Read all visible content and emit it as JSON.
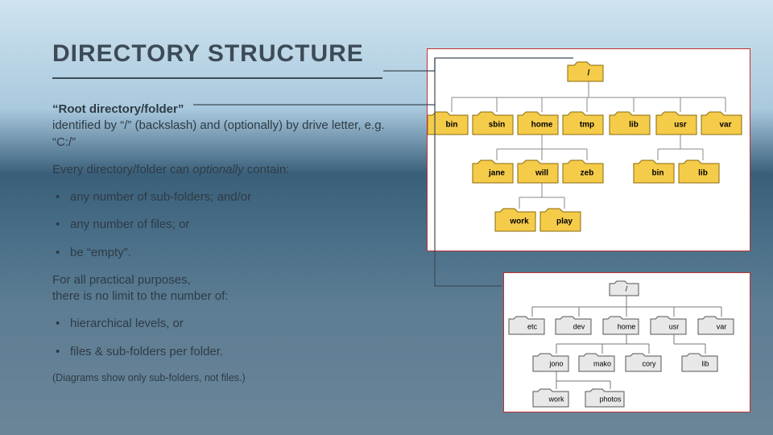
{
  "title": "DIRECTORY STRUCTURE",
  "para1_bold": "“Root directory/folder”",
  "para1_rest": "identified by “/” (backslash) and (optionally) by drive letter, e.g. “C:/”",
  "para2_pre": "Every directory/folder can ",
  "para2_em": "optionally",
  "para2_post": " contain:",
  "list1": [
    "any number of sub-folders; and/or",
    "any number of files; or",
    "be “empty”."
  ],
  "para3": "For all practical purposes,\nthere is no limit to the number of:",
  "list2": [
    "hierarchical levels, or",
    "files & sub-folders per folder."
  ],
  "footnote": "(Diagrams show only sub-folders, not files.)",
  "diagram1": {
    "root": "/",
    "level1": [
      "bin",
      "sbin",
      "home",
      "tmp",
      "lib",
      "usr",
      "var"
    ],
    "level2_home": [
      "jane",
      "will",
      "zeb"
    ],
    "level2_usr": [
      "bin",
      "lib"
    ],
    "level3_will": [
      "work",
      "play"
    ]
  },
  "diagram2": {
    "root": "/",
    "level1": [
      "etc",
      "dev",
      "home",
      "usr",
      "var"
    ],
    "level2_home": [
      "jono",
      "mako",
      "cory"
    ],
    "level2_usr": [
      "lib"
    ],
    "level3_jono": [
      "work",
      "photos"
    ]
  }
}
